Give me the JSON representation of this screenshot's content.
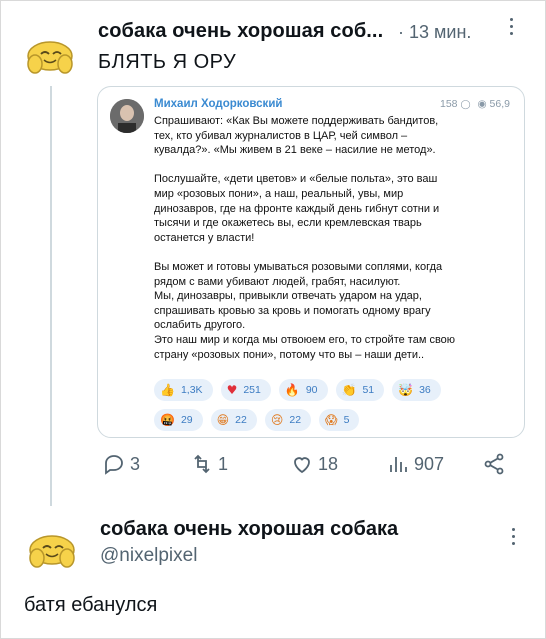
{
  "tweet1": {
    "display_name": "собака очень хорошая соб...",
    "separator": "·",
    "time": "13 мин.",
    "text": "БЛЯТЬ Я ОРУ",
    "avatar_icon": "smiling-face-avatar-icon"
  },
  "embed": {
    "author": "Михаил Ходорковский",
    "comments": "158",
    "views": "56,9",
    "paragraphs": [
      "Спрашивают: «Как Вы можете поддерживать бандитов,\nтех, кто убивал журналистов в ЦАР, чей символ –\nкувалда?». «Мы живем в 21 веке – насилие не метод».",
      "Послушайте, «дети цветов» и «белые польта», это ваш\nмир «розовых пони», а наш, реальный, увы, мир\nдинозавров, где на фронте каждый день гибнут сотни и\nтысячи и где окажетесь вы, если кремлевская тварь\nостанется у власти!",
      "Вы может и готовы умываться розовыми соплями, когда\nрядом с вами убивают людей, грабят, насилуют.\nМы, динозавры, привыкли отвечать ударом на удар,\nспрашивать кровью за кровь и помогать одному врагу\nослабить другого.\nЭто наш мир и когда мы отвоюем его, то стройте там свою\nстрану «розовых пони», потому что вы – наши дети.."
    ],
    "reactions_row1": [
      {
        "emoji": "👍",
        "count": "1,3K"
      },
      {
        "emoji": "♥",
        "count": "251"
      },
      {
        "emoji": "🔥",
        "count": "90"
      },
      {
        "emoji": "👏",
        "count": "51"
      },
      {
        "emoji": "🤯",
        "count": "36"
      }
    ],
    "reactions_row2": [
      {
        "emoji": "🤬",
        "count": "29"
      },
      {
        "emoji": "😁",
        "count": "22"
      },
      {
        "emoji": "😢",
        "count": "22"
      },
      {
        "emoji": "😱",
        "count": "5"
      }
    ]
  },
  "actions": {
    "replies": "3",
    "retweets": "1",
    "likes": "18",
    "views": "907"
  },
  "tweet2": {
    "display_name": "собака очень хорошая собака",
    "handle": "@nixelpixel",
    "text": "батя ебанулся"
  },
  "colors": {
    "accent": "#3a8ad1",
    "muted": "#536471",
    "reaction_bg": "#e7f0fa"
  }
}
